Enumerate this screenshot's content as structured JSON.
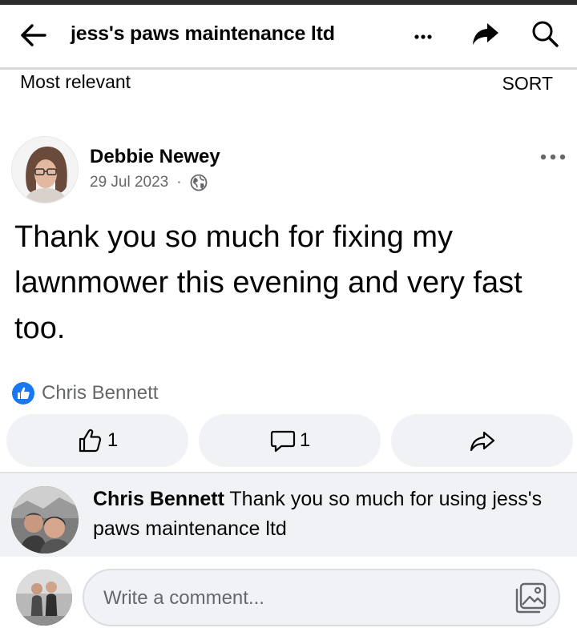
{
  "header": {
    "title": "jess's paws maintenance ltd",
    "back_icon": "back-arrow-icon",
    "more_icon": "more-horizontal-icon",
    "share_icon": "share-icon",
    "search_icon": "search-icon"
  },
  "sortbar": {
    "filter_label": "Most relevant",
    "sort_label": "SORT"
  },
  "post": {
    "author": "Debbie Newey",
    "date": "29 Jul 2023",
    "separator": "·",
    "audience_icon": "globe-icon",
    "text": "Thank you so much for fixing my lawnmower this evening and very fast too.",
    "reactions": {
      "icon": "like-reaction-icon",
      "names": "Chris Bennett",
      "color": "#1877f2"
    },
    "actions": [
      {
        "icon": "thumbs-up-icon",
        "count": "1"
      },
      {
        "icon": "comment-icon",
        "count": "1"
      },
      {
        "icon": "share-icon",
        "count": ""
      }
    ]
  },
  "comment": {
    "author": "Chris Bennett",
    "text": "Thank you so much for using jess's paws maintenance ltd"
  },
  "composer": {
    "placeholder": "Write a comment...",
    "photo_icon": "photo-icon"
  }
}
